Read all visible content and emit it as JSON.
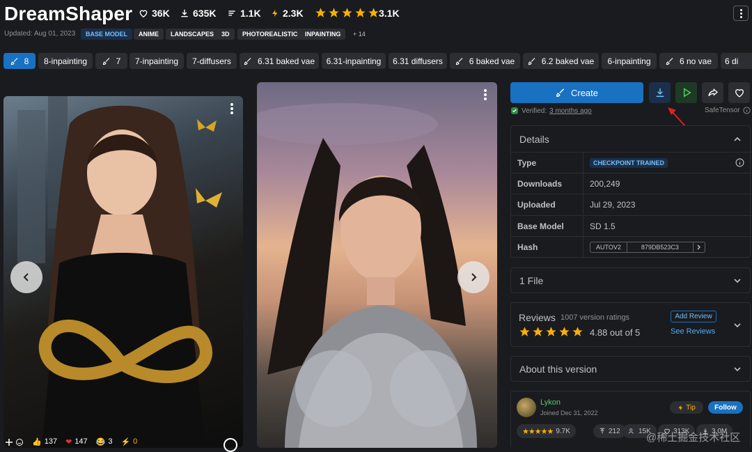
{
  "header": {
    "title": "DreamShaper",
    "stats": {
      "likes": "36K",
      "downloads": "635K",
      "comments": "1.1K",
      "buzz": "2.3K",
      "rating_count": "3.1K"
    },
    "updated": "Updated: Aug 01, 2023",
    "tags": [
      "BASE MODEL",
      "ANIME",
      "LANDSCAPES",
      "3D",
      "PHOTOREALISTIC",
      "INPAINTING"
    ],
    "more_tags": "+ 14"
  },
  "versions": [
    "8",
    "8-inpainting",
    "7",
    "7-inpainting",
    "7-diffusers",
    "6.31 baked vae",
    "6.31-inpainting",
    "6.31 diffusers",
    "6 baked vae",
    "6.2 baked vae",
    "6-inpainting",
    "6 no vae",
    "6 di"
  ],
  "images": {
    "reactions": {
      "likes": "137",
      "hearts": "147",
      "laugh": "3",
      "buzz": "0"
    }
  },
  "actions": {
    "create_label": "Create",
    "verified": "Verified:",
    "verified_time": "3 months ago",
    "safetensor": "SafeTensor"
  },
  "details": {
    "header": "Details",
    "rows": [
      {
        "label": "Type",
        "value": "CHECKPOINT TRAINED"
      },
      {
        "label": "Downloads",
        "value": "200,249"
      },
      {
        "label": "Uploaded",
        "value": "Jul 29, 2023"
      },
      {
        "label": "Base Model",
        "value": "SD 1.5"
      },
      {
        "label": "Hash",
        "hash_type": "AUTOV2",
        "hash_value": "879DB523C3"
      }
    ]
  },
  "files": {
    "header": "1 File"
  },
  "reviews": {
    "header": "Reviews",
    "count": "1007 version ratings",
    "rating_text": "4.88 out of 5",
    "stars": 5,
    "add_label": "Add Review",
    "see_label": "See Reviews"
  },
  "about": {
    "header": "About this version"
  },
  "creator": {
    "name": "Lykon",
    "joined": "Joined Dec 31, 2022",
    "tip_label": "Tip",
    "follow_label": "Follow",
    "rating": "9.7K",
    "uploads": "212",
    "followers": "15K",
    "favorites": "313K",
    "downloads": "3.0M"
  },
  "watermark": "@稀土掘金技术社区",
  "colors": {
    "accent": "#1971c2",
    "star": "#fab005",
    "bg": "#1a1b1e",
    "green": "#2b8a3e"
  }
}
